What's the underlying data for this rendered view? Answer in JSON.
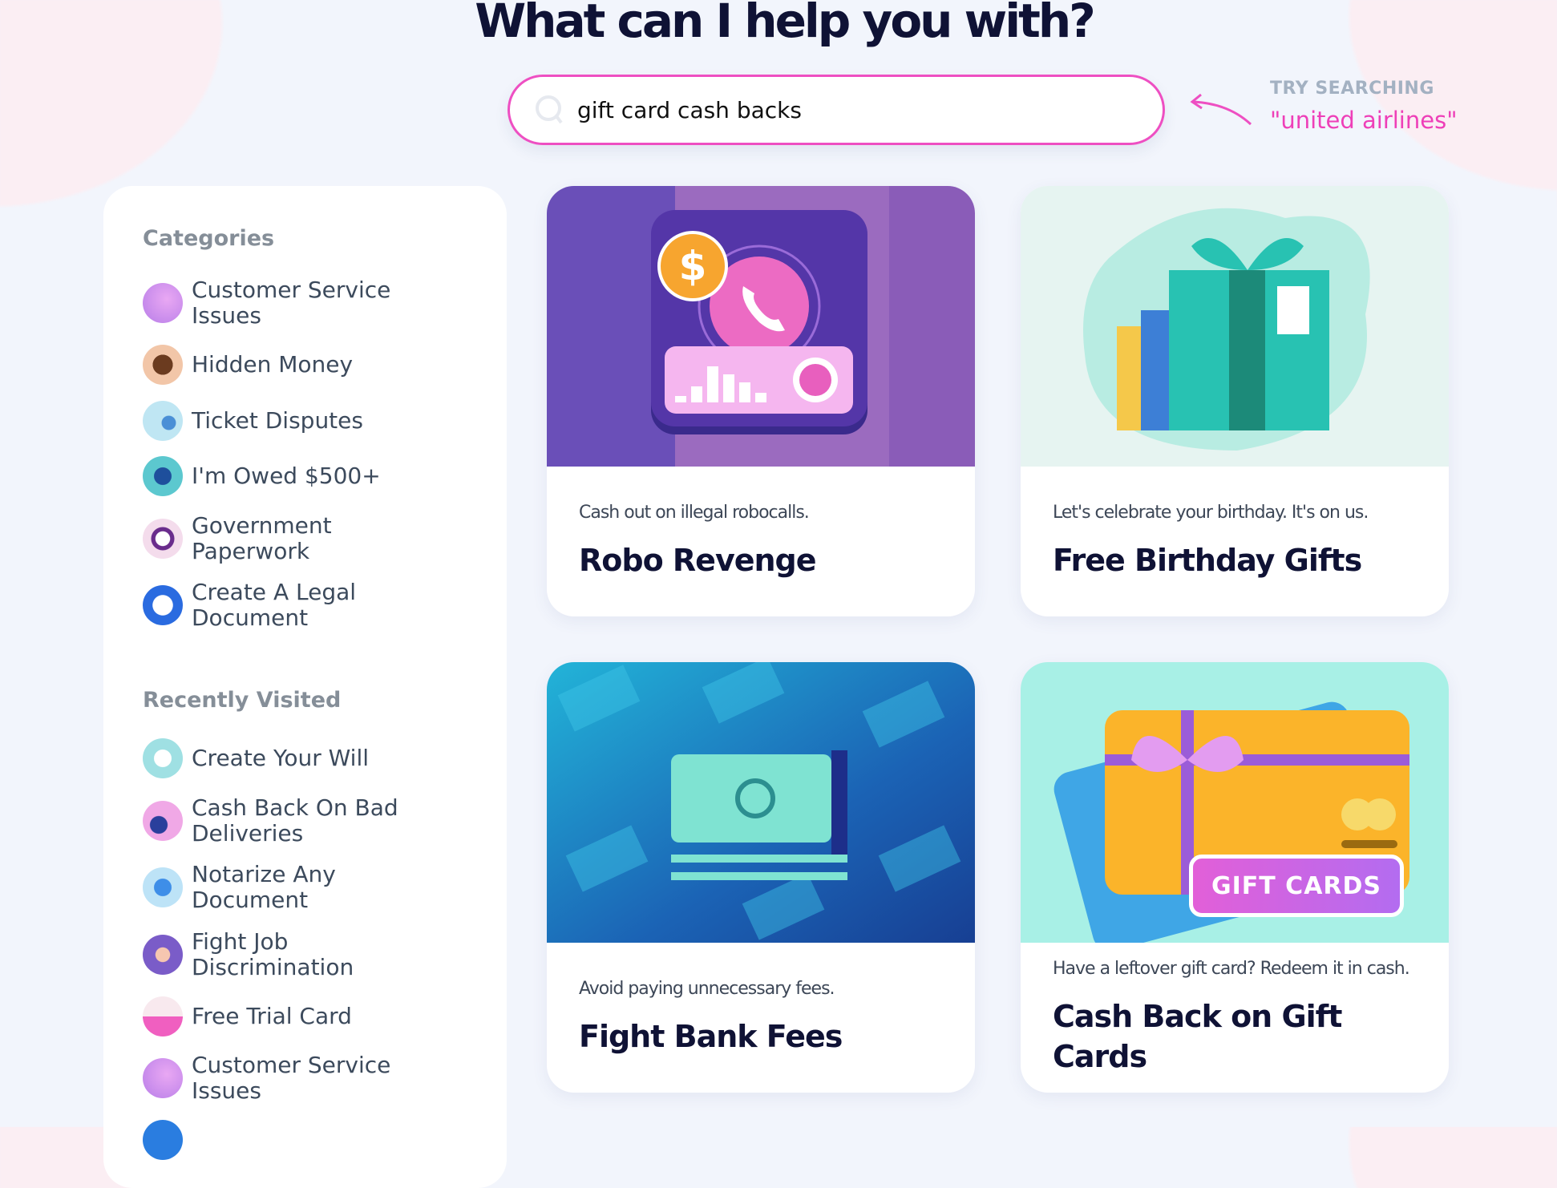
{
  "header": {
    "title": "What can I help you with?"
  },
  "search": {
    "value": "gift card cash backs",
    "hint_label": "TRY SEARCHING",
    "hint_value": "united airlines",
    "accent": "#ee4fc2"
  },
  "sidebar": {
    "categories_title": "Categories",
    "categories": [
      {
        "label": "Customer Service Issues",
        "icon": "delivery-truck-icon"
      },
      {
        "label": "Hidden Money",
        "icon": "treasure-chest-icon"
      },
      {
        "label": "Ticket Disputes",
        "icon": "ticket-car-icon"
      },
      {
        "label": "I'm Owed $500+",
        "icon": "courthouse-icon"
      },
      {
        "label": "Government Paperwork",
        "icon": "paperwork-icon"
      },
      {
        "label": "Create A Legal Document",
        "icon": "legal-document-icon"
      }
    ],
    "recent_title": "Recently Visited",
    "recent": [
      {
        "label": "Create Your Will",
        "icon": "will-icon"
      },
      {
        "label": "Cash Back On Bad Deliveries",
        "icon": "delivery-icon"
      },
      {
        "label": "Notarize Any Document",
        "icon": "notarize-icon"
      },
      {
        "label": "Fight Job Discrimination",
        "icon": "discrimination-icon"
      },
      {
        "label": "Free Trial Card",
        "icon": "trial-card-icon"
      },
      {
        "label": "Customer Service Issues",
        "icon": "delivery-truck-icon"
      }
    ]
  },
  "cards": [
    {
      "subtitle": "Cash out on illegal robocalls.",
      "title": "Robo Revenge"
    },
    {
      "subtitle": "Let's celebrate your birthday. It's on us.",
      "title": "Free Birthday Gifts"
    },
    {
      "subtitle": "Avoid paying unnecessary fees.",
      "title": "Fight Bank Fees"
    },
    {
      "subtitle": "Have a leftover gift card? Redeem it in cash.",
      "title": "Cash Back on Gift Cards",
      "image_label": "GIFT CARDS"
    }
  ]
}
